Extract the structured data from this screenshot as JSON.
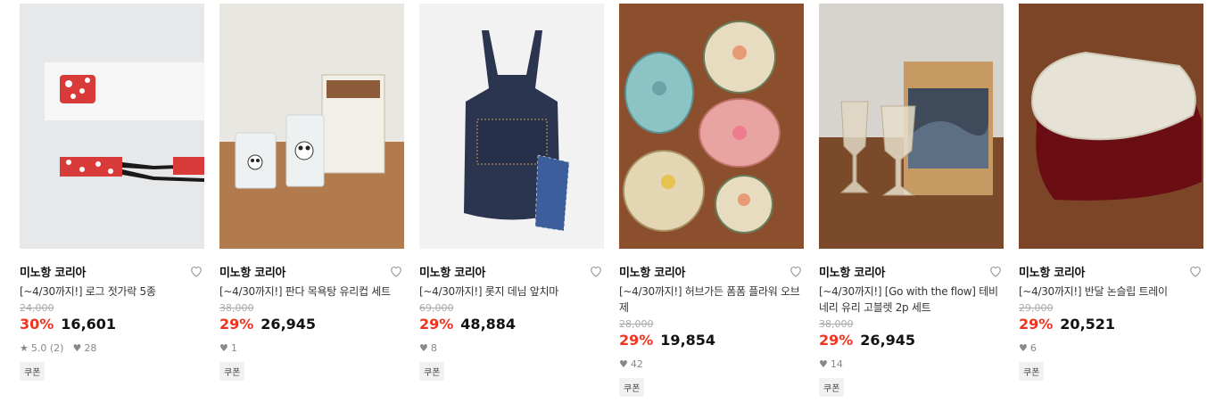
{
  "products": [
    {
      "brand": "미노항 코리아",
      "title": "[~4/30까지!] 로그 젓가락 5종",
      "original_price": "24,000",
      "discount": "30%",
      "price": "16,601",
      "rating": "5.0 (2)",
      "likes": "28",
      "coupon": "쿠폰",
      "image_icon": "chopsticks-image"
    },
    {
      "brand": "미노항 코리아",
      "title": "[~4/30까지!] 판다 목욕탕 유리컵 세트",
      "original_price": "38,000",
      "discount": "29%",
      "price": "26,945",
      "rating": "",
      "likes": "1",
      "coupon": "쿠폰",
      "image_icon": "panda-glass-image"
    },
    {
      "brand": "미노항 코리아",
      "title": "[~4/30까지!] 롯지 데님 앞치마",
      "original_price": "69,000",
      "discount": "29%",
      "price": "48,884",
      "rating": "",
      "likes": "8",
      "coupon": "쿠폰",
      "image_icon": "denim-apron-image"
    },
    {
      "brand": "미노항 코리아",
      "title": "[~4/30까지!] 허브가든 폼폼 플라워 오브제",
      "original_price": "28,000",
      "discount": "29%",
      "price": "19,854",
      "rating": "",
      "likes": "42",
      "coupon": "쿠폰",
      "image_icon": "flower-plates-image"
    },
    {
      "brand": "미노항 코리아",
      "title": "[~4/30까지!] [Go with the flow] 테비네리 유리 고블렛 2p 세트",
      "original_price": "38,000",
      "discount": "29%",
      "price": "26,945",
      "rating": "",
      "likes": "14",
      "coupon": "쿠폰",
      "image_icon": "glass-goblet-image"
    },
    {
      "brand": "미노항 코리아",
      "title": "[~4/30까지!] 반달 논슬립 트레이",
      "original_price": "29,000",
      "discount": "29%",
      "price": "20,521",
      "rating": "",
      "likes": "6",
      "coupon": "쿠폰",
      "image_icon": "half-moon-tray-image"
    }
  ],
  "colors": {
    "discount": "#f0341f",
    "muted": "#888888"
  }
}
